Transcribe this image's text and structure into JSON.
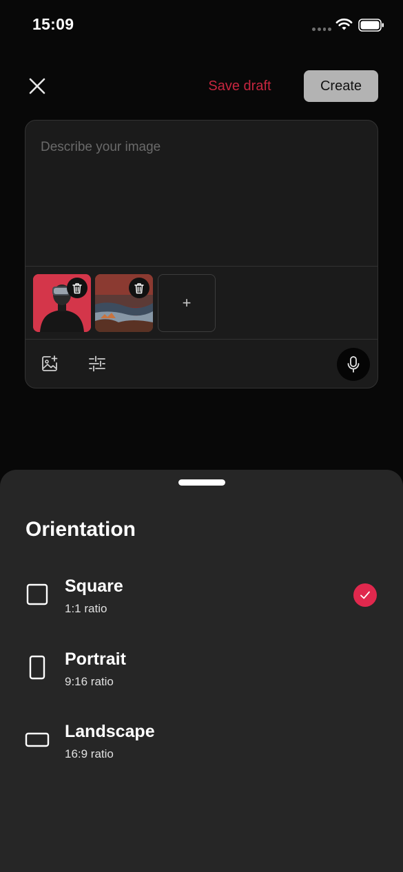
{
  "status_bar": {
    "time": "15:09"
  },
  "top_bar": {
    "close_icon": "close-icon",
    "save_draft_label": "Save draft",
    "create_label": "Create"
  },
  "composer": {
    "prompt_placeholder": "Describe your image",
    "add_image_symbol": "+",
    "thumbnails": [
      {
        "description_icon": "image-thumbnail"
      },
      {
        "description_icon": "image-thumbnail"
      }
    ],
    "icons": {
      "delete": "trash-icon",
      "add_photo": "image-plus-icon",
      "settings": "sliders-icon",
      "voice": "microphone-icon"
    }
  },
  "orientation_sheet": {
    "title": "Orientation",
    "selected": "Square",
    "options": [
      {
        "label": "Square",
        "ratio": "1:1 ratio",
        "icon": "square-icon"
      },
      {
        "label": "Portrait",
        "ratio": "9:16 ratio",
        "icon": "portrait-icon"
      },
      {
        "label": "Landscape",
        "ratio": "16:9 ratio",
        "icon": "landscape-icon"
      }
    ]
  },
  "colors": {
    "accent": "#e0284d",
    "save_draft": "#c7263f",
    "create_button_bg": "#b3b3b3",
    "background": "#080808",
    "sheet_bg": "#262626",
    "card_bg": "#1b1b1b"
  }
}
